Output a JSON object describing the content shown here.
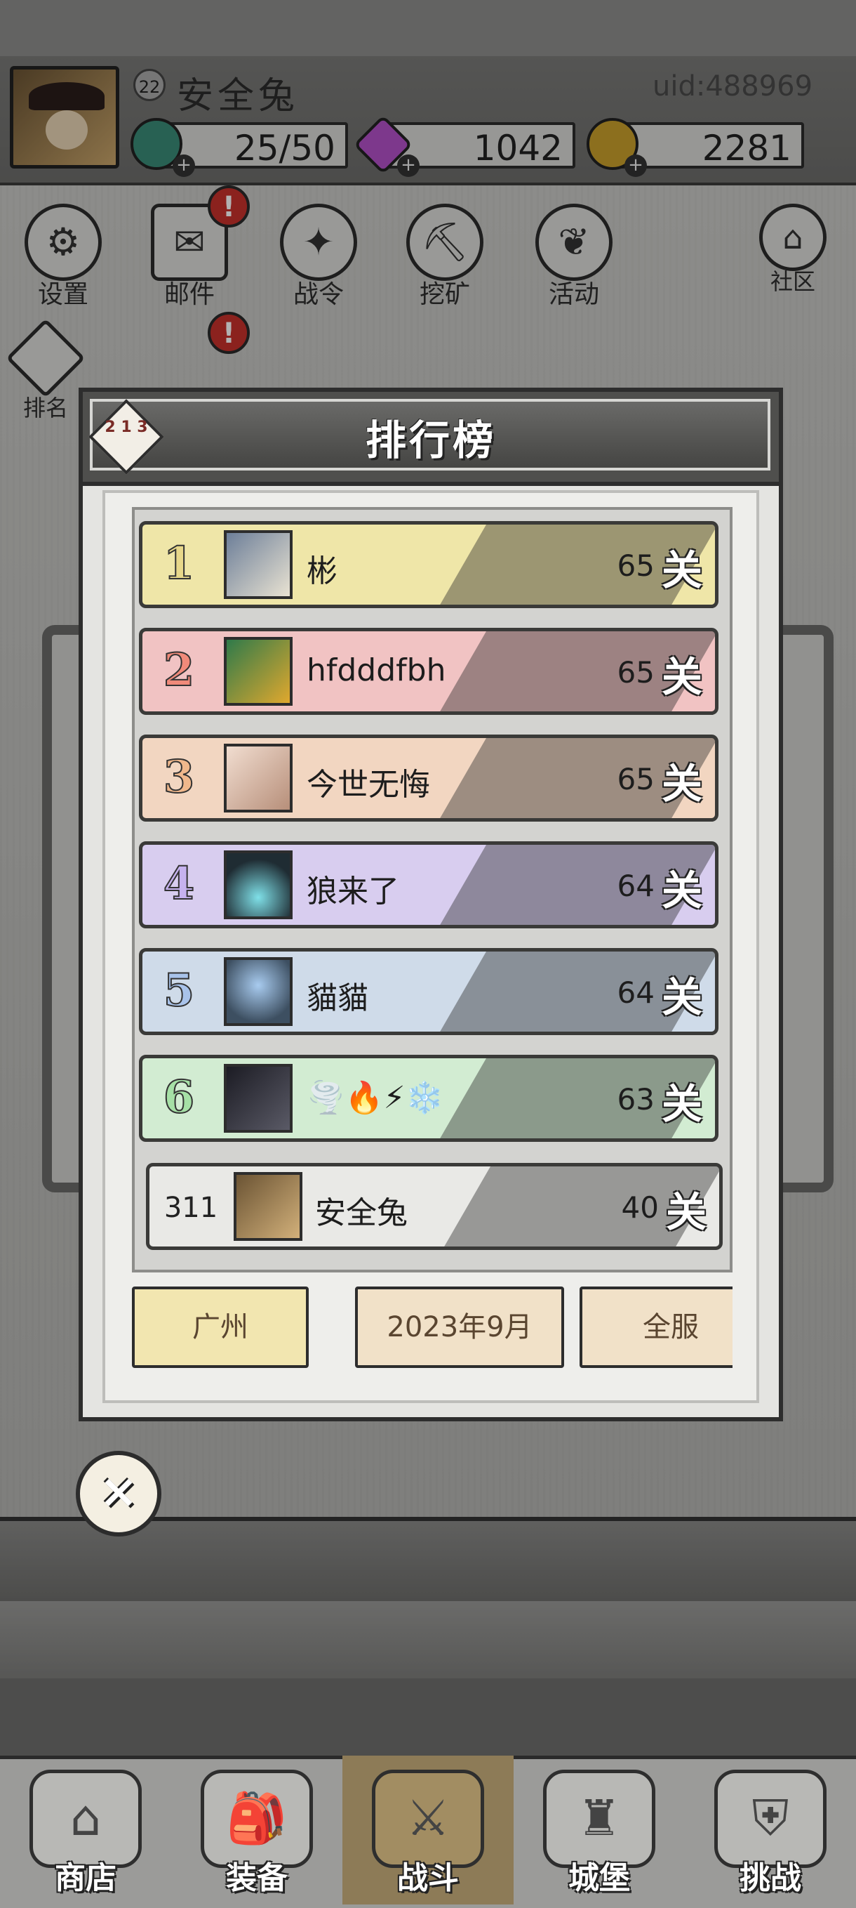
{
  "player": {
    "level": "22",
    "name": "安全兔",
    "uid": "uid:488969"
  },
  "resources": {
    "stamina": "25/50",
    "gems": "1042",
    "coins": "2281"
  },
  "top_menu": {
    "settings": "设置",
    "mail": "邮件",
    "battle_pass": "战令",
    "mining": "挖矿",
    "events": "活动",
    "community": "社区",
    "ranking_side": "排名",
    "mail_badge": "!",
    "gift_badge": "!"
  },
  "leaderboard": {
    "title": "排行榜",
    "emblem": "2 1 3",
    "unit": "关",
    "rows": [
      {
        "rank": "1",
        "name": "彬",
        "score": "65",
        "color": "#efe6a8",
        "num_color": "#e8d88a"
      },
      {
        "rank": "2",
        "name": "hfdddfbh",
        "score": "65",
        "color": "#f1c3c3",
        "num_color": "#f08a7a"
      },
      {
        "rank": "3",
        "name": "今世无悔",
        "score": "65",
        "color": "#f2d6c1",
        "num_color": "#f0b88c"
      },
      {
        "rank": "4",
        "name": "狼来了",
        "score": "64",
        "color": "#d8cdef",
        "num_color": "#c6b2ef"
      },
      {
        "rank": "5",
        "name": "貓貓",
        "score": "64",
        "color": "#cfdbe9",
        "num_color": "#a9c3ea"
      },
      {
        "rank": "6",
        "name": "🌪️🔥⚡❄️",
        "score": "63",
        "color": "#d2ecd2",
        "num_color": "#a6e0a6"
      }
    ],
    "self": {
      "rank": "311",
      "name": "安全兔",
      "score": "40"
    }
  },
  "tabs": {
    "region": "广州",
    "month": "2023年9月",
    "server": "全服"
  },
  "bottom_nav": {
    "shop": "商店",
    "equipment": "装备",
    "battle": "战斗",
    "castle": "城堡",
    "challenge": "挑战"
  },
  "icons": {
    "close": "×"
  }
}
